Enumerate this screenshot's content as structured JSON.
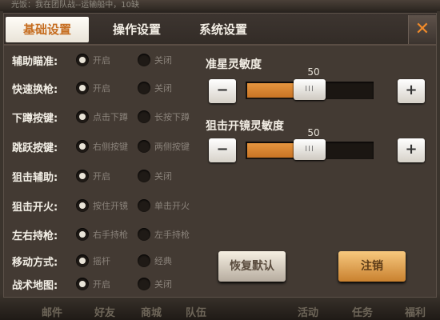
{
  "background": {
    "top_chat": "光饭：我在团队战--运输船中，10缺",
    "bottom_ghosts": [
      "邮件",
      "好友",
      "商城",
      "队伍",
      "活动",
      "任务",
      "福利"
    ]
  },
  "tabs": [
    "基础设置",
    "操作设置",
    "系统设置"
  ],
  "active_tab": 0,
  "close_symbol": "✕",
  "settings": [
    {
      "label": "辅助瞄准:",
      "options": [
        "开启",
        "关闭"
      ],
      "selected": 0
    },
    {
      "label": "快速换枪:",
      "options": [
        "开启",
        "关闭"
      ],
      "selected": 0
    },
    {
      "label": "下蹲按键:",
      "options": [
        "点击下蹲",
        "长按下蹲"
      ],
      "selected": 0
    },
    {
      "label": "跳跃按键:",
      "options": [
        "右侧按键",
        "两侧按键"
      ],
      "selected": 0
    },
    {
      "label": "狙击辅助:",
      "options": [
        "开启",
        "关闭"
      ],
      "selected": 0
    },
    {
      "label": "狙击开火:",
      "options": [
        "按住开镜",
        "单击开火"
      ],
      "selected": 0
    },
    {
      "label": "左右持枪:",
      "options": [
        "右手持枪",
        "左手持枪"
      ],
      "selected": 0
    },
    {
      "label": "移动方式:",
      "options": [
        "摇杆",
        "经典"
      ],
      "selected": 0
    },
    {
      "label": "战术地图:",
      "options": [
        "开启",
        "关闭"
      ],
      "selected": 0
    }
  ],
  "sliders": [
    {
      "title": "准星灵敏度",
      "value": "50",
      "level": 0.5,
      "minus": "−",
      "plus": "+",
      "thumb": "III"
    },
    {
      "title": "狙击开镜灵敏度",
      "value": "50",
      "level": 0.5,
      "minus": "−",
      "plus": "+",
      "thumb": "III"
    }
  ],
  "buttons": {
    "restore": "恢复默认",
    "cancel": "注销"
  },
  "colors": {
    "accent": "#c66d20",
    "panel": "#433a33",
    "fill": "#d8822f"
  }
}
